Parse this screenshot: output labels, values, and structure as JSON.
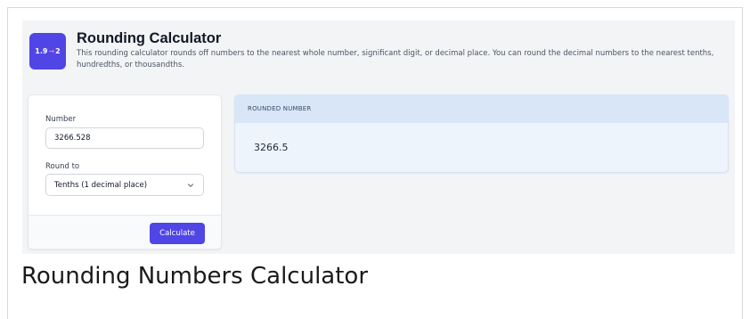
{
  "header": {
    "logo": {
      "from": "1.9",
      "to": "2"
    },
    "title": "Rounding Calculator",
    "description": "This rounding calculator rounds off numbers to the nearest whole number, significant digit, or decimal place. You can round the decimal numbers to the nearest tenths, hundredths, or thousandths."
  },
  "form": {
    "number_label": "Number",
    "number_value": "3266.528",
    "round_to_label": "Round to",
    "round_to_selected": "Tenths (1 decimal place)",
    "calculate_label": "Calculate"
  },
  "result": {
    "label": "ROUNDED NUMBER",
    "value": "3266.5"
  },
  "page_heading": "Rounding Numbers Calculator",
  "colors": {
    "accent": "#4f46e5",
    "result_header": "#d8e6f7",
    "result_body": "#eef4fb"
  }
}
